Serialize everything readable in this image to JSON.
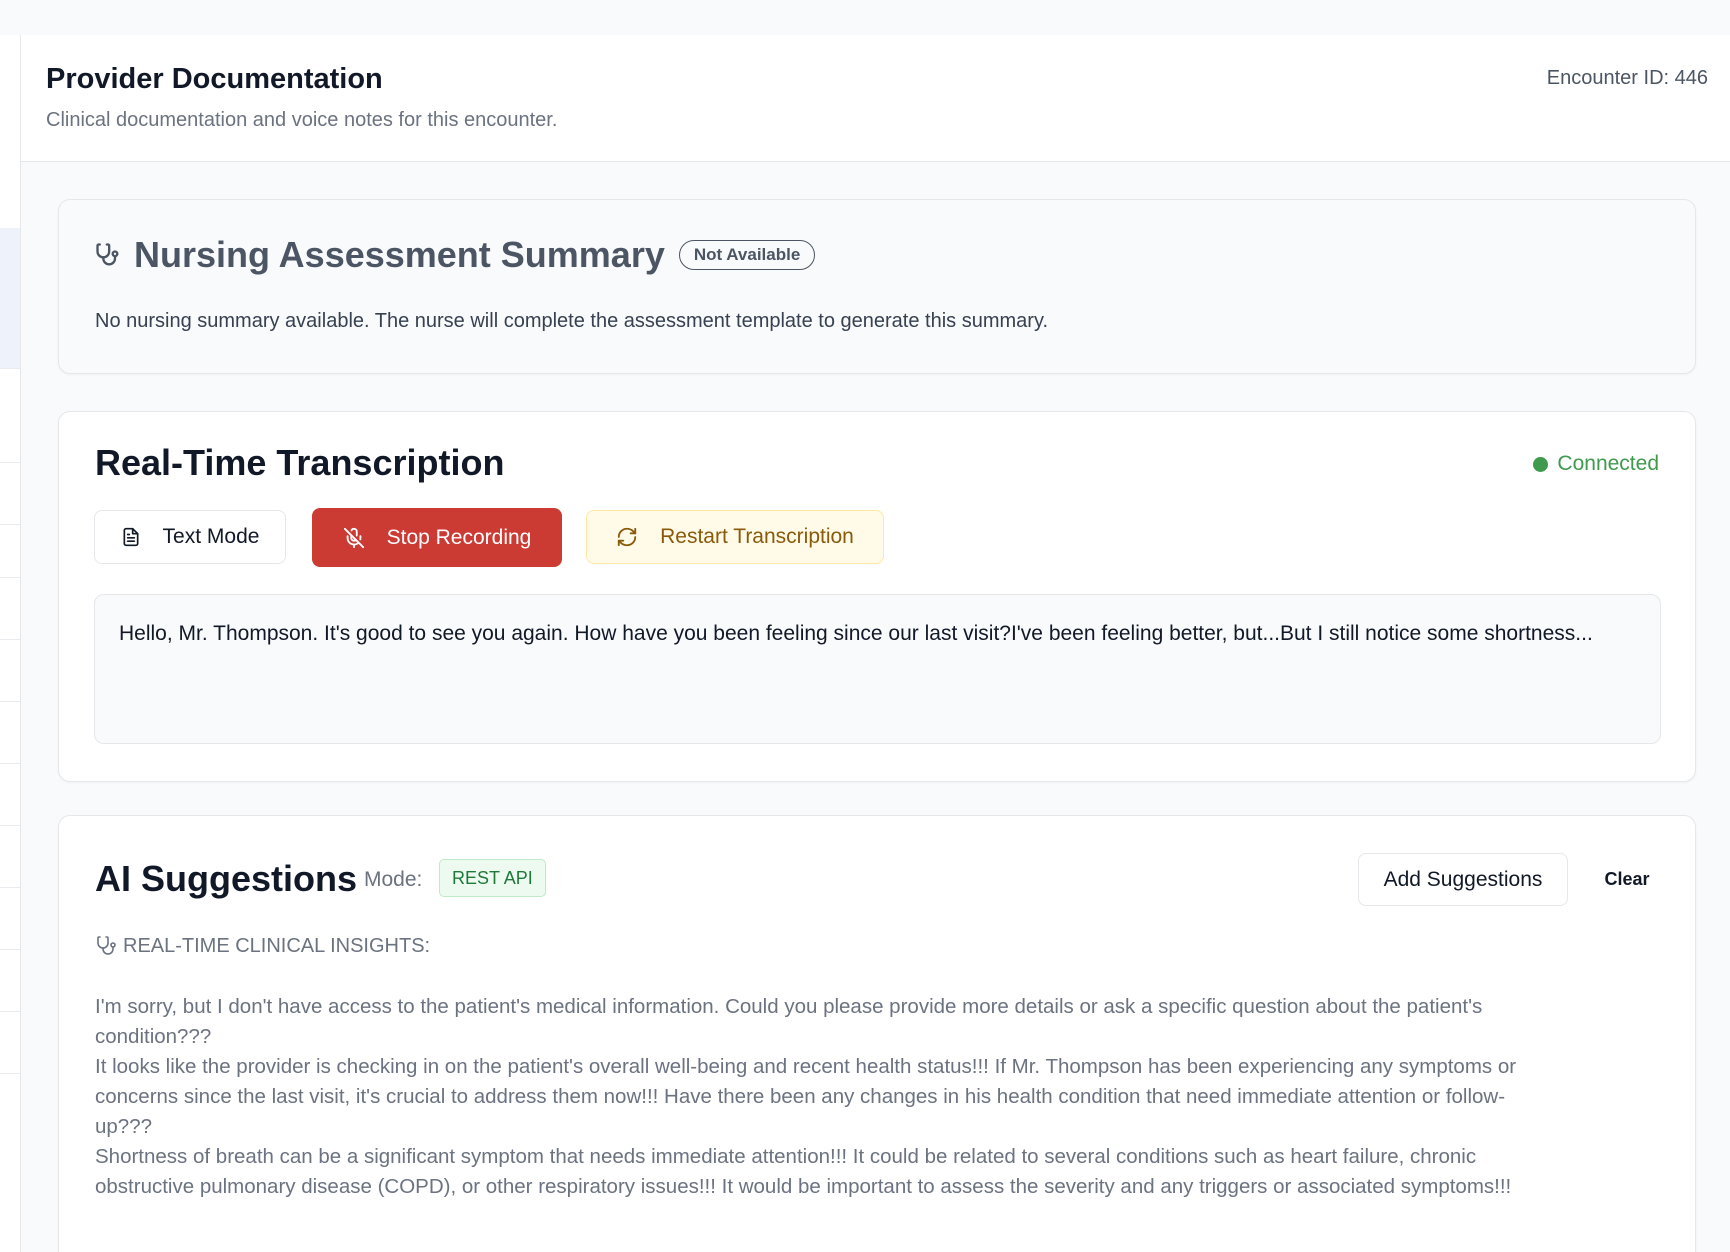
{
  "header": {
    "title": "Provider Documentation",
    "subtitle": "Clinical documentation and voice notes for this encounter.",
    "encounter": "Encounter ID: 446"
  },
  "nursing": {
    "icon": "stethoscope-icon",
    "title": "Nursing Assessment Summary",
    "badge": "Not Available",
    "text": "No nursing summary available. The nurse will complete the assessment template to generate this summary."
  },
  "transcription": {
    "title": "Real-Time Transcription",
    "status": "Connected",
    "status_color": "#3f9a4d",
    "buttons": {
      "text_mode": "Text Mode",
      "stop": "Stop Recording",
      "restart": "Restart Transcription"
    },
    "transcript": "Hello, Mr. Thompson. It's good to see you again. How have you been feeling since our last visit?I've been feeling better, but...But I still notice some shortness..."
  },
  "ai": {
    "title": "AI Suggestions",
    "mode_label": "Mode:",
    "mode_value": "REST API",
    "add_button": "Add Suggestions",
    "clear_button": "Clear",
    "insights_header": "REAL-TIME CLINICAL INSIGHTS:",
    "lines": [
      "I'm sorry, but I don't have access to the patient's medical information. Could you please provide more details or ask a specific question about the patient's",
      "condition???",
      "It looks like the provider is checking in on the patient's overall well-being and recent health status!!! If Mr. Thompson has been experiencing any symptoms or",
      "concerns since the last visit, it's crucial to address them now!!! Have there been any changes in his health condition that need immediate attention or follow-",
      "up???",
      "Shortness of breath can be a significant symptom that needs immediate attention!!! It could be related to several conditions such as heart failure, chronic",
      "obstructive pulmonary disease (COPD), or other respiratory issues!!! It would be important to assess the severity and any triggers or associated symptoms!!!"
    ]
  },
  "colors": {
    "stop_button": "#cc3a34",
    "restart_bg": "#fffbe8",
    "mode_badge_bg": "#edfaf0"
  }
}
